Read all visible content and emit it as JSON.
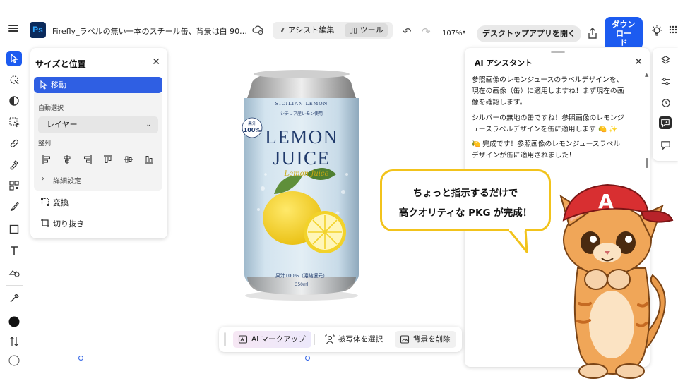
{
  "header": {
    "app_logo": "Ps",
    "doc_title": "Firefly_ラベルの無い一本のスチール缶、背景は白 90…",
    "mode_assist": "アシスト編集",
    "mode_tools": "ツール",
    "zoom": "107%",
    "open_desktop": "デスクトップアプリを開く",
    "download_line1": "ダウン",
    "download_line2": "ロー",
    "download_line3": "ド"
  },
  "size_panel": {
    "title": "サイズと位置",
    "move": "移動",
    "auto_select_label": "自動選択",
    "layer_option": "レイヤー",
    "align_label": "整列",
    "detail": "詳細設定",
    "transform": "変換",
    "crop": "切り抜き"
  },
  "ai_panel": {
    "title": "AI アシスタント",
    "msg1_l1": "参照画像のレモンジュースのラベルデザインを、",
    "msg1_l2": "現在の画像（缶）に適用しますね！まず現在の画",
    "msg1_l3": "像を確認します。",
    "msg2_l1": "シルバーの無地の缶ですね！参照画像のレモンジ",
    "msg2_l2": "ュースラベルデザインを缶に適用します 🍋 ✨",
    "msg3_l1": "🍋 完成です！参照画像のレモンジュースラベル",
    "msg3_l2": "デザインが缶に適用されました！"
  },
  "float_toolbar": {
    "ai_markup": "AI マークアップ",
    "select_subject": "被写体を選択",
    "remove_bg": "背景を削除"
  },
  "can": {
    "brand_arc": "SICILIAN LEMON",
    "sub": "シチリア産レモン使用",
    "name1": "LEMON",
    "name2": "JUICE",
    "script": "Lemon Juice",
    "badge_l1": "果汁",
    "badge_l2": "100%",
    "juice": "果汁100%（濃縮還元）",
    "volume": "350ml"
  },
  "bubble": {
    "line1": "ちょっと指示するだけで",
    "line2": "高クオリティな PKG が完成！"
  },
  "mascot": {
    "cap_letter": "A"
  },
  "colors": {
    "accent": "#1c5bf0",
    "bubble_border": "#f2c31b",
    "can_label": "#cfe1ee",
    "can_text": "#203a6b"
  }
}
